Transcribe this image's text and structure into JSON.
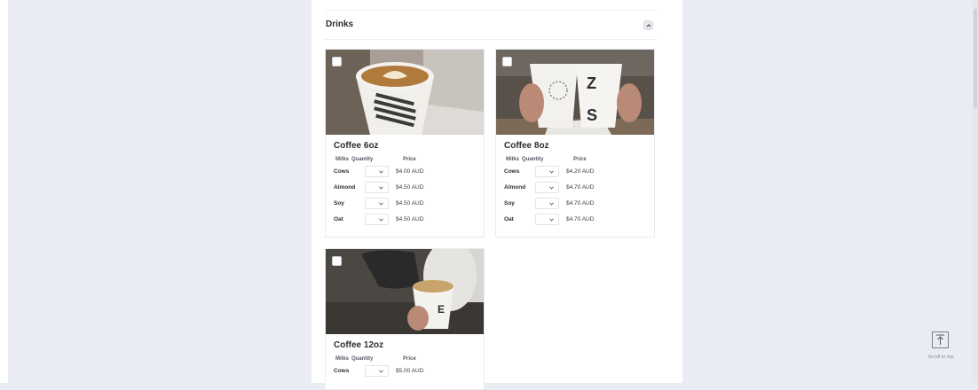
{
  "section": {
    "title": "Drinks"
  },
  "table_headers": {
    "milks": "Milks",
    "quantity": "Quantity",
    "price": "Price"
  },
  "products": [
    {
      "name": "Coffee 6oz",
      "image_icon": "coffee-cup-latte-art-image",
      "rows": [
        {
          "milk": "Cows",
          "price": "$4.00 AUD"
        },
        {
          "milk": "Almond",
          "price": "$4.50 AUD"
        },
        {
          "milk": "Soy",
          "price": "$4.50 AUD"
        },
        {
          "milk": "Oat",
          "price": "$4.50 AUD"
        }
      ]
    },
    {
      "name": "Coffee 8oz",
      "image_icon": "two-coffee-cups-image",
      "rows": [
        {
          "milk": "Cows",
          "price": "$4.20 AUD"
        },
        {
          "milk": "Almond",
          "price": "$4.70 AUD"
        },
        {
          "milk": "Soy",
          "price": "$4.70 AUD"
        },
        {
          "milk": "Oat",
          "price": "$4.70 AUD"
        }
      ]
    },
    {
      "name": "Coffee 12oz",
      "image_icon": "barista-pouring-milk-image",
      "rows": [
        {
          "milk": "Cows",
          "price": "$5.00 AUD"
        }
      ]
    }
  ],
  "scroll_to_top": {
    "label": "Scroll to top",
    "icon": "arrow-up-to-line-icon"
  },
  "colors": {
    "page_background": "#e9edf3",
    "panel_background": "#ffffff",
    "text": "#2c2c34"
  }
}
